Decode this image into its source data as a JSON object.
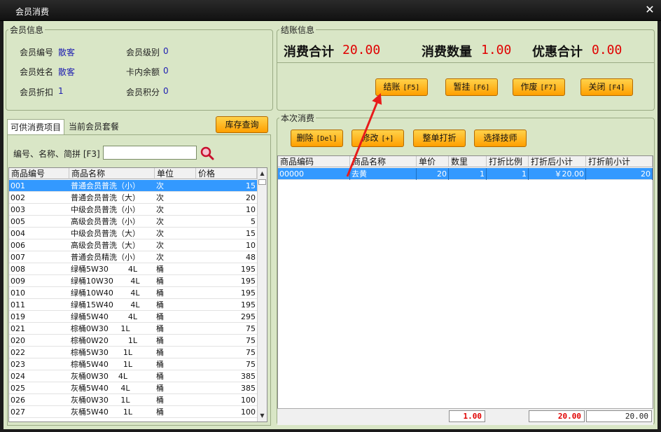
{
  "window": {
    "title": "会员消费"
  },
  "member_info": {
    "legend": "会员信息",
    "no_label": "会员编号",
    "no_value": "散客",
    "level_label": "会员级别",
    "level_value": "0",
    "name_label": "会员姓名",
    "name_value": "散客",
    "balance_label": "卡内余额",
    "balance_value": "0",
    "discount_label": "会员折扣",
    "discount_value": "1",
    "points_label": "会员积分",
    "points_value": "0"
  },
  "checkout_info": {
    "legend": "结账信息",
    "total_label": "消费合计",
    "total_value": "20.00",
    "qty_label": "消费数量",
    "qty_value": "1.00",
    "discount_label": "优惠合计",
    "discount_value": "0.00"
  },
  "action_buttons": [
    {
      "label": "结账",
      "key": "[F5]"
    },
    {
      "label": "暂挂",
      "key": "[F6]"
    },
    {
      "label": "作废",
      "key": "[F7]"
    },
    {
      "label": "关闭",
      "key": "[F4]"
    }
  ],
  "tabs": {
    "items": [
      "可供消费项目",
      "当前会员套餐"
    ],
    "active": 0
  },
  "stock_button": "库存查询",
  "search": {
    "label": "编号、名称、简拼 [F3]",
    "value": ""
  },
  "product_table": {
    "columns": [
      "商品编号",
      "商品名称",
      "单位",
      "价格"
    ],
    "rows": [
      [
        "001",
        "普通会员普洗（小）",
        "次",
        "15"
      ],
      [
        "002",
        "普通会员普洗（大）",
        "次",
        "20"
      ],
      [
        "003",
        "中级会员普洗（小）",
        "次",
        "10"
      ],
      [
        "005",
        "高级会员普洗（小）",
        "次",
        "5"
      ],
      [
        "004",
        "中级会员普洗（大）",
        "次",
        "15"
      ],
      [
        "006",
        "高级会员普洗（大）",
        "次",
        "10"
      ],
      [
        "007",
        "普通会员精洗（小）",
        "次",
        "48"
      ],
      [
        "008",
        "绿桶5W30        4L",
        "桶",
        "195"
      ],
      [
        "009",
        "绿桶10W30       4L",
        "桶",
        "195"
      ],
      [
        "010",
        "绿桶10W40       4L",
        "桶",
        "195"
      ],
      [
        "011",
        "绿桶15W40       4L",
        "桶",
        "195"
      ],
      [
        "019",
        "绿桶5W40        4L",
        "桶",
        "295"
      ],
      [
        "021",
        "棕桶0W30     1L",
        "桶",
        "75"
      ],
      [
        "020",
        "棕桶0W20        1L",
        "桶",
        "75"
      ],
      [
        "022",
        "棕桶5W30      1L",
        "桶",
        "75"
      ],
      [
        "023",
        "棕桶5W40      1L",
        "桶",
        "75"
      ],
      [
        "024",
        "灰桶0W30    4L",
        "桶",
        "385"
      ],
      [
        "025",
        "灰桶5W40     4L",
        "桶",
        "385"
      ],
      [
        "026",
        "灰桶0W30     1L",
        "桶",
        "100"
      ],
      [
        "027",
        "灰桶5W40      1L",
        "桶",
        "100"
      ]
    ],
    "selected_row": 0
  },
  "current_consumption": {
    "legend": "本次消费",
    "buttons": [
      "删除",
      "修改",
      "整单打折",
      "选择技师"
    ],
    "button_keys": [
      "[Del]",
      "[+]",
      "",
      ""
    ],
    "columns": [
      "商品编码",
      "商品名称",
      "单价",
      "数里",
      "打折比例",
      "打折后小计",
      "打折前小计"
    ],
    "rows": [
      [
        "00000",
        "去黄",
        "20",
        "1",
        "1",
        "￥20.00",
        "20"
      ]
    ],
    "totals": {
      "qty": "1.00",
      "after": "20.00",
      "before": "20.00"
    }
  },
  "colors": {
    "accent_red": "#e00000",
    "button_orange": "#ff9f00",
    "panel_green": "#d9e6c6",
    "selection_blue": "#3399ff"
  }
}
